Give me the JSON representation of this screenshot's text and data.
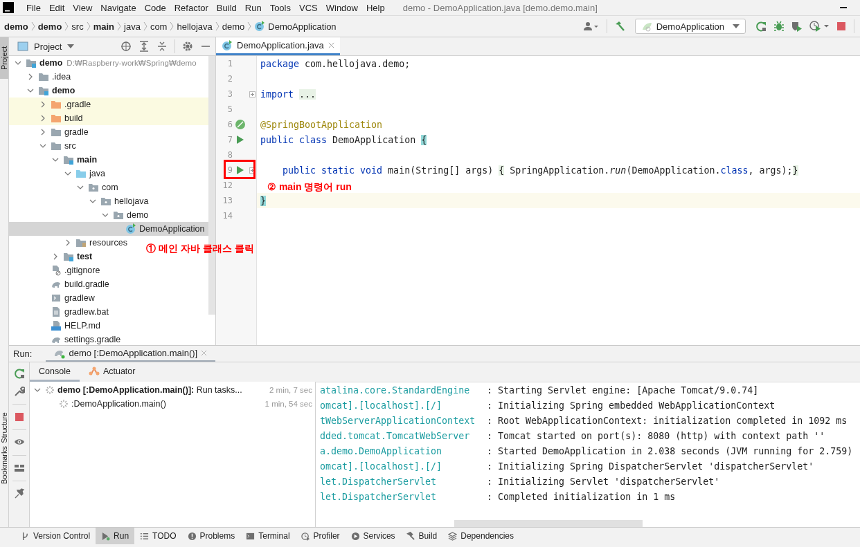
{
  "window": {
    "title": "demo - DemoApplication.java [demo.demo.main]"
  },
  "menu": [
    "File",
    "Edit",
    "View",
    "Navigate",
    "Code",
    "Refactor",
    "Build",
    "Run",
    "Tools",
    "VCS",
    "Window",
    "Help"
  ],
  "breadcrumbs": [
    {
      "label": "demo",
      "kind": "module"
    },
    {
      "label": "demo",
      "kind": "module"
    },
    {
      "label": "src",
      "kind": "folder"
    },
    {
      "label": "main",
      "kind": "module"
    },
    {
      "label": "java",
      "kind": "folder"
    },
    {
      "label": "com",
      "kind": "folder"
    },
    {
      "label": "hellojava",
      "kind": "folder"
    },
    {
      "label": "demo",
      "kind": "folder"
    },
    {
      "label": "DemoApplication",
      "kind": "class"
    }
  ],
  "toolbar": {
    "run_config": "DemoApplication"
  },
  "side_tabs": [
    {
      "label": "Project",
      "selected": true
    },
    {
      "label": "Structure",
      "selected": false
    },
    {
      "label": "Bookmarks",
      "selected": false
    }
  ],
  "project_panel": {
    "title": "Project",
    "tree": [
      {
        "label": "demo",
        "hint": "D:₩Raspberry-work₩Spring₩demo",
        "kind": "module",
        "expanded": true,
        "selected": false,
        "children": [
          {
            "label": ".idea",
            "kind": "folder",
            "expanded": false,
            "selected": false
          },
          {
            "label": "demo",
            "kind": "module",
            "expanded": true,
            "selected": false,
            "children": [
              {
                "label": ".gradle",
                "kind": "excluded-folder",
                "expanded": false,
                "selected": false
              },
              {
                "label": "build",
                "kind": "excluded-folder",
                "expanded": false,
                "selected": false
              },
              {
                "label": "gradle",
                "kind": "folder",
                "expanded": false,
                "selected": false
              },
              {
                "label": "src",
                "kind": "folder",
                "expanded": true,
                "selected": false,
                "children": [
                  {
                    "label": "main",
                    "kind": "module",
                    "expanded": true,
                    "selected": false,
                    "children": [
                      {
                        "label": "java",
                        "kind": "source-folder",
                        "expanded": true,
                        "selected": false,
                        "children": [
                          {
                            "label": "com",
                            "kind": "package",
                            "expanded": true,
                            "selected": false,
                            "children": [
                              {
                                "label": "hellojava",
                                "kind": "package",
                                "expanded": true,
                                "selected": false,
                                "children": [
                                  {
                                    "label": "demo",
                                    "kind": "package",
                                    "expanded": true,
                                    "selected": false,
                                    "children": [
                                      {
                                        "label": "DemoApplication",
                                        "kind": "spring-class",
                                        "selected": true
                                      }
                                    ]
                                  }
                                ]
                              }
                            ]
                          }
                        ]
                      },
                      {
                        "label": "resources",
                        "kind": "resources-folder",
                        "expanded": false,
                        "selected": false
                      }
                    ]
                  },
                  {
                    "label": "test",
                    "kind": "module",
                    "expanded": false,
                    "selected": false
                  }
                ]
              },
              {
                "label": ".gitignore",
                "kind": "ignore-file",
                "selected": false
              },
              {
                "label": "build.gradle",
                "kind": "gradle-file",
                "selected": false
              },
              {
                "label": "gradlew",
                "kind": "shell-file",
                "selected": false
              },
              {
                "label": "gradlew.bat",
                "kind": "text-file",
                "selected": false
              },
              {
                "label": "HELP.md",
                "kind": "md-file",
                "selected": false
              },
              {
                "label": "settings.gradle",
                "kind": "gradle-file",
                "selected": false
              }
            ]
          }
        ]
      }
    ]
  },
  "editor": {
    "tab": {
      "label": "DemoApplication.java",
      "selected": true
    },
    "lines": [
      {
        "number": "1",
        "run_marker": false,
        "spring_marker": false,
        "folded": false,
        "current": false,
        "indented": false,
        "segments": [
          {
            "kind": "keyword",
            "text": "package"
          },
          {
            "kind": "plain",
            "text": " com.hellojava.demo;"
          }
        ]
      },
      {
        "number": "2",
        "run_marker": false,
        "spring_marker": false,
        "folded": false,
        "current": false
      },
      {
        "number": "3",
        "run_marker": false,
        "spring_marker": false,
        "folded": true,
        "current": false,
        "indented": false,
        "segments": [
          {
            "kind": "keyword",
            "text": "import "
          },
          {
            "kind": "folded",
            "text": "..."
          }
        ]
      },
      {
        "number": "5",
        "run_marker": false,
        "spring_marker": false,
        "folded": false,
        "current": false
      },
      {
        "number": "6",
        "run_marker": false,
        "spring_marker": true,
        "folded": false,
        "current": false,
        "indented": false,
        "segments": [
          {
            "kind": "annotation",
            "text": "@SpringBootApplication"
          }
        ]
      },
      {
        "number": "7",
        "run_marker": true,
        "spring_marker": false,
        "folded": false,
        "current": false,
        "indented": false,
        "segments": [
          {
            "kind": "keyword",
            "text": "public class"
          },
          {
            "kind": "plain",
            "text": " DemoApplication "
          },
          {
            "kind": "brace",
            "text": "{"
          }
        ]
      },
      {
        "number": "8",
        "run_marker": false,
        "spring_marker": false,
        "folded": false,
        "current": false
      },
      {
        "number": "9",
        "run_marker": true,
        "spring_marker": false,
        "folded": true,
        "current": false,
        "indented": true,
        "segments": [
          {
            "kind": "keyword",
            "text": "public static void"
          },
          {
            "kind": "plain",
            "text": " main(String[] args) "
          },
          {
            "kind": "folded",
            "text": "{"
          },
          {
            "kind": "plain",
            "text": " SpringApplication."
          },
          {
            "kind": "italic",
            "text": "run"
          },
          {
            "kind": "plain",
            "text": "(DemoApplication."
          },
          {
            "kind": "keyword",
            "text": "class"
          },
          {
            "kind": "plain",
            "text": ", args);"
          },
          {
            "kind": "folded",
            "text": "}"
          }
        ]
      },
      {
        "number": "12",
        "run_marker": false,
        "spring_marker": false,
        "folded": false,
        "current": false
      },
      {
        "number": "13",
        "run_marker": false,
        "spring_marker": false,
        "folded": false,
        "current": true,
        "indented": false,
        "segments": [
          {
            "kind": "brace",
            "text": "}"
          }
        ]
      },
      {
        "number": "14",
        "run_marker": false,
        "spring_marker": false,
        "folded": false,
        "current": false
      }
    ]
  },
  "annotations": [
    {
      "text": "① 메인 자바 클래스 클릭"
    },
    {
      "text": "② main 명령어 run"
    }
  ],
  "run_panel": {
    "label": "Run:",
    "session_tab": "demo [:DemoApplication.main()]",
    "tabs": [
      {
        "label": "Console",
        "selected": true
      },
      {
        "label": "Actuator",
        "selected": false
      }
    ],
    "tasks": [
      {
        "text": "**demo [:DemoApplication.main()]:** Run tasks...",
        "time": "2 min, 7 sec",
        "expanded": true,
        "children": [
          {
            "text": ":DemoApplication.main()",
            "time": "1 min, 54 sec"
          }
        ]
      }
    ],
    "console": [
      {
        "source": "atalina.core.StandardEngine",
        "message": ": Starting Servlet engine: [Apache Tomcat/9.0.74]"
      },
      {
        "source": "omcat].[localhost].[/]",
        "message": ": Initializing Spring embedded WebApplicationContext"
      },
      {
        "source": "tWebServerApplicationContext",
        "message": ": Root WebApplicationContext: initialization completed in 1092 ms"
      },
      {
        "source": "dded.tomcat.TomcatWebServer",
        "message": ": Tomcat started on port(s): 8080 (http) with context path ''"
      },
      {
        "source": "a.demo.DemoApplication",
        "message": ": Started DemoApplication in 2.038 seconds (JVM running for 2.759)"
      },
      {
        "source": "omcat].[localhost].[/]",
        "message": ": Initializing Spring DispatcherServlet 'dispatcherServlet'"
      },
      {
        "source": "let.DispatcherServlet",
        "message": ": Initializing Servlet 'dispatcherServlet'"
      },
      {
        "source": "let.DispatcherServlet",
        "message": ": Completed initialization in 1 ms"
      }
    ]
  },
  "tool_windows": [
    {
      "label": "Version Control",
      "selected": false
    },
    {
      "label": "Run",
      "selected": true
    },
    {
      "label": "TODO",
      "selected": false
    },
    {
      "label": "Problems",
      "selected": false
    },
    {
      "label": "Terminal",
      "selected": false
    },
    {
      "label": "Profiler",
      "selected": false
    },
    {
      "label": "Services",
      "selected": false
    },
    {
      "label": "Build",
      "selected": false
    },
    {
      "label": "Dependencies",
      "selected": false
    }
  ]
}
